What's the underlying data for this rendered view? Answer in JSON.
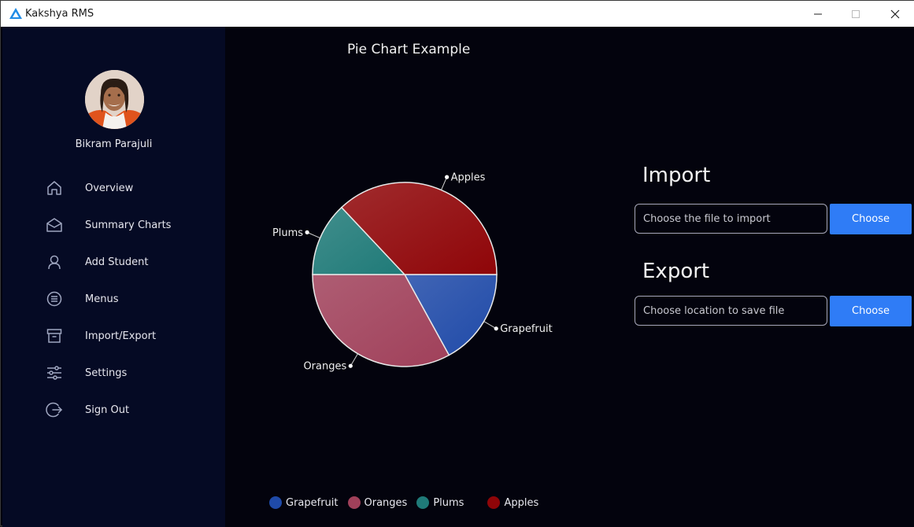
{
  "window": {
    "title": "Kakshya RMS",
    "controls": [
      "minimize",
      "maximize",
      "close"
    ]
  },
  "sidebar": {
    "profile_name": "Bikram Parajuli",
    "items": [
      {
        "label": "Overview",
        "icon": "home-icon"
      },
      {
        "label": "Summary Charts",
        "icon": "envelope-icon"
      },
      {
        "label": "Add Student",
        "icon": "user-icon"
      },
      {
        "label": "Menus",
        "icon": "menu-circle-icon"
      },
      {
        "label": "Import/Export",
        "icon": "archive-icon"
      },
      {
        "label": "Settings",
        "icon": "sliders-icon"
      },
      {
        "label": "Sign Out",
        "icon": "sign-out-icon"
      }
    ]
  },
  "import_section": {
    "title": "Import",
    "placeholder": "Choose the file to import",
    "button_label": "Choose"
  },
  "export_section": {
    "title": "Export",
    "placeholder": "Choose location to save file",
    "button_label": "Choose"
  },
  "colors": {
    "accent": "#2f7cf6",
    "sidebar_bg": "#050a24",
    "main_bg": "#03030d"
  },
  "chart_data": {
    "type": "pie",
    "title": "Pie Chart Example",
    "categories": [
      "Grapefruit",
      "Oranges",
      "Plums",
      "Apples"
    ],
    "values": [
      17,
      33,
      13,
      37
    ],
    "colors": [
      "#1f4aa8",
      "#a0405a",
      "#1f7a78",
      "#8f0508"
    ],
    "legend_position": "bottom"
  }
}
